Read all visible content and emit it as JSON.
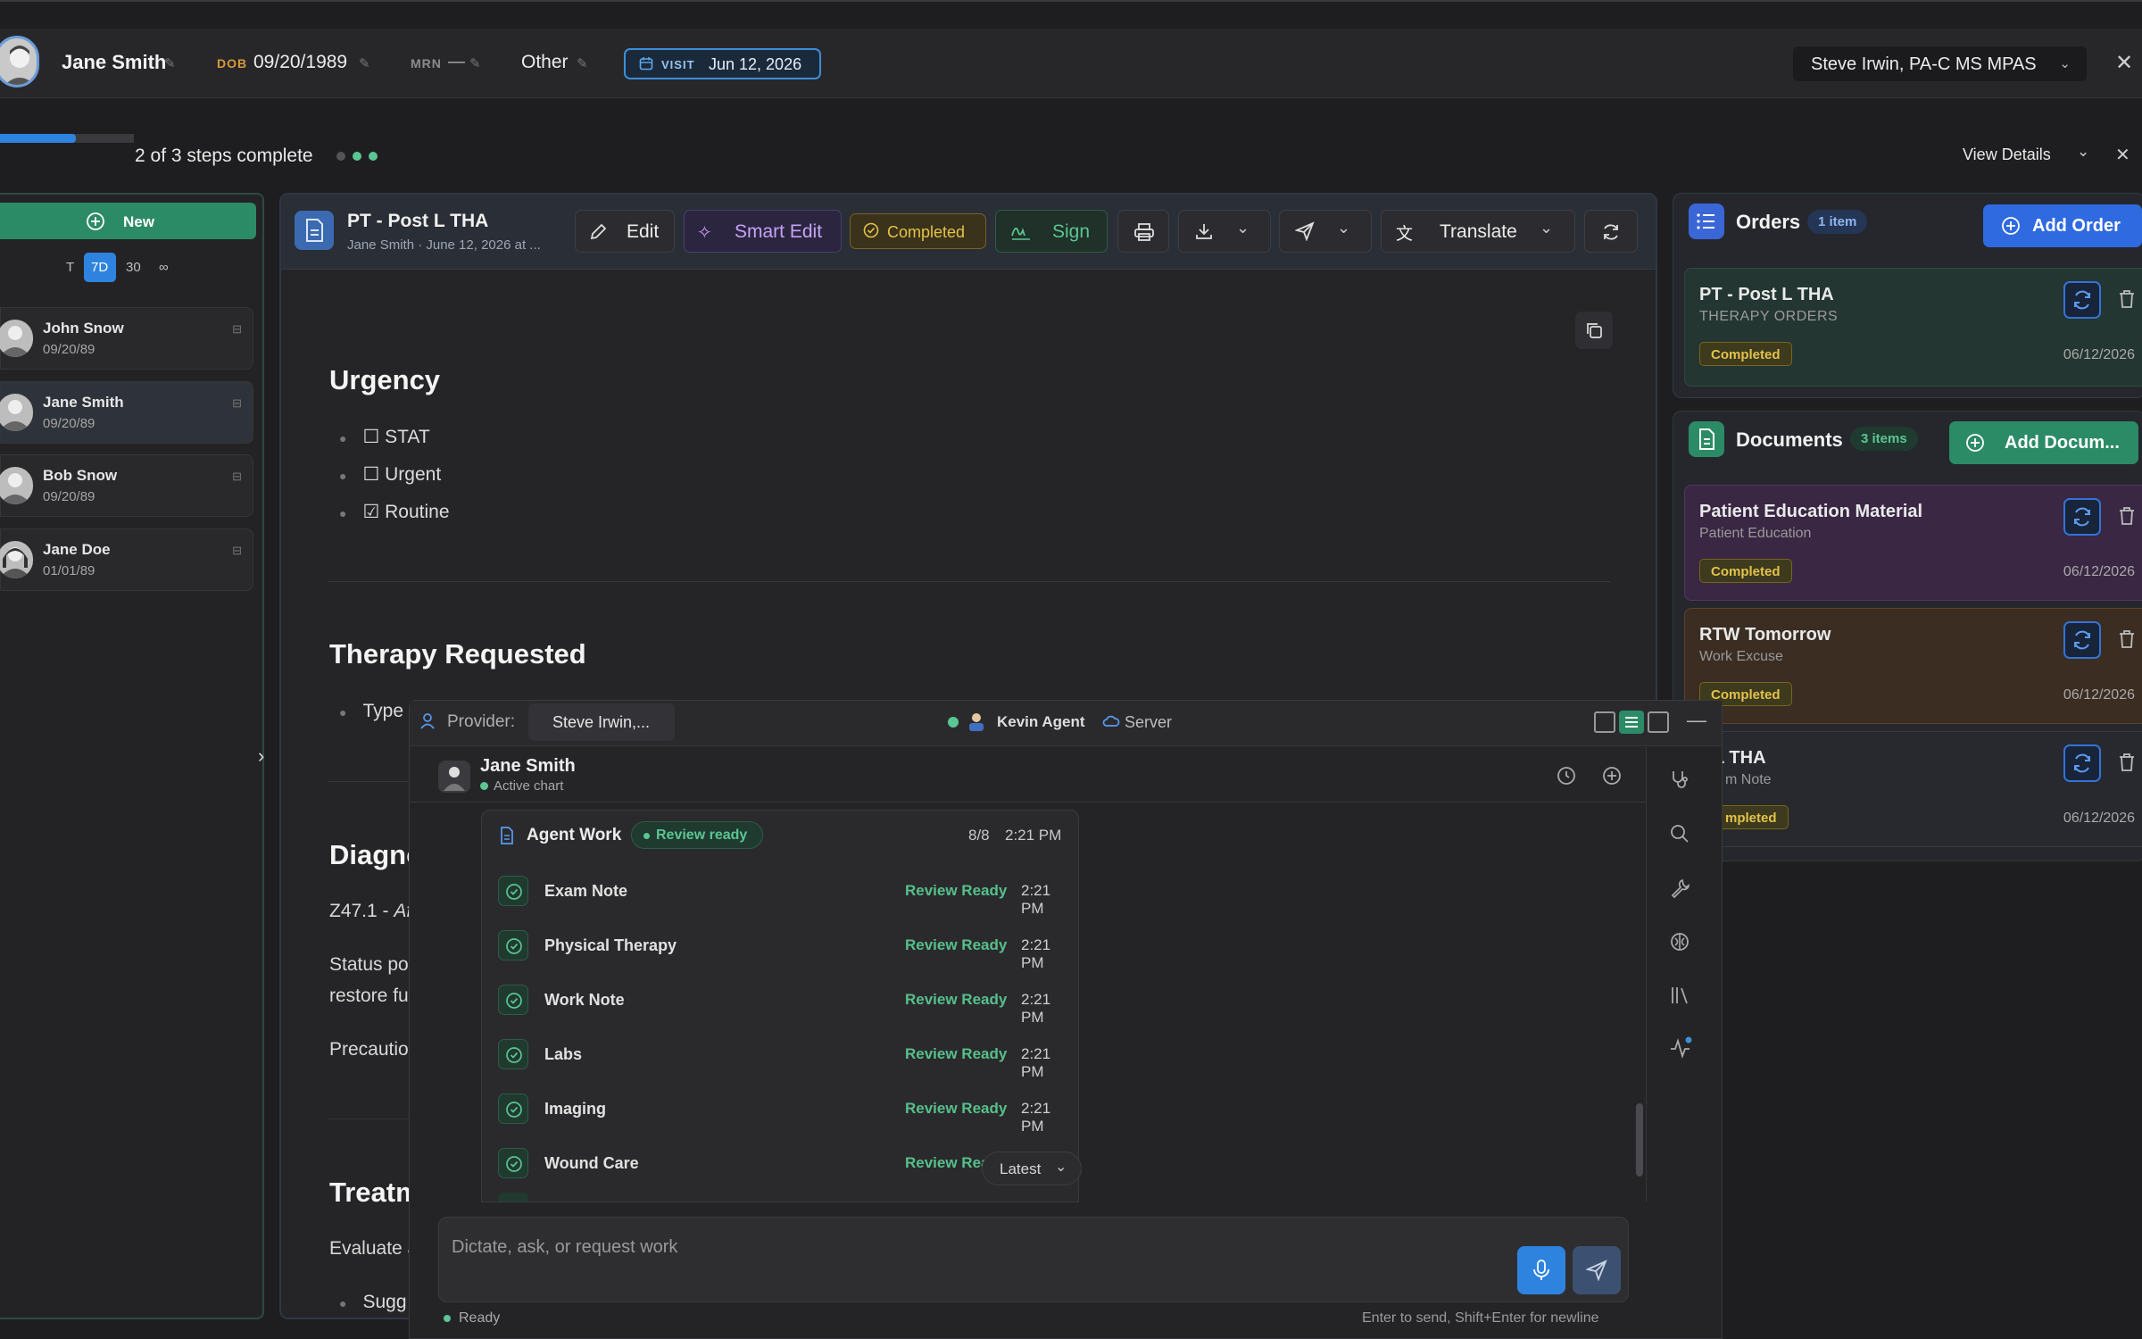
{
  "topbar": {
    "patient_name": "Jane Smith",
    "dob_label": "DOB",
    "dob": "09/20/1989",
    "mrn_label": "MRN",
    "mrn": "—",
    "gender": "Other",
    "visit_label": "VISIT",
    "visit_date": "Jun 12, 2026",
    "provider": "Steve Irwin, PA-C MS MPAS"
  },
  "progress": {
    "text": "2 of 3 steps complete",
    "fraction": 0.57,
    "view_details": "View Details"
  },
  "sidebar": {
    "new_label": "New",
    "ranges": [
      "T",
      "7D",
      "30",
      "∞"
    ],
    "active_range": "7D",
    "patients": [
      {
        "name": "John Snow",
        "dob": "09/20/89"
      },
      {
        "name": "Jane Smith",
        "dob": "09/20/89"
      },
      {
        "name": "Bob Snow",
        "dob": "09/20/89"
      },
      {
        "name": "Jane Doe",
        "dob": "01/01/89"
      }
    ]
  },
  "document": {
    "title": "PT - Post L THA",
    "subtitle": "Jane Smith · June 12, 2026 at ...",
    "toolbar": {
      "edit": "Edit",
      "smart_edit": "Smart Edit",
      "completed": "Completed",
      "sign": "Sign",
      "translate": "Translate"
    },
    "urgency_heading": "Urgency",
    "urgency_items": [
      "☐ STAT",
      "☐ Urgent",
      "☑ Routine"
    ],
    "therapy_heading": "Therapy Requested",
    "therapy_item": "Type",
    "diagnosis_heading": "Diagno",
    "diagnosis_code": "Z47.1 - ",
    "diagnosis_code_italic": "Af",
    "status_line1": "Status po",
    "status_line2": "restore fu",
    "precautions": "Precautio",
    "treatment_heading": "Treatm",
    "evaluate": "Evaluate a",
    "suggest": "Sugg"
  },
  "orders": {
    "title": "Orders",
    "count": "1 item",
    "add_label": "Add Order",
    "items": [
      {
        "title": "PT - Post L THA",
        "subtitle": "THERAPY ORDERS",
        "status": "Completed",
        "date": "06/12/2026"
      }
    ]
  },
  "documents": {
    "title": "Documents",
    "count": "3 items",
    "add_label": "Add Docum...",
    "items": [
      {
        "title": "Patient Education Material",
        "subtitle": "Patient Education",
        "status": "Completed",
        "date": "06/12/2026"
      },
      {
        "title": "RTW Tomorrow",
        "subtitle": "Work Excuse",
        "status": "Completed",
        "date": "06/12/2026"
      },
      {
        "title": "L THA",
        "subtitle": "m Note",
        "status": "mpleted",
        "date": "06/12/2026"
      }
    ]
  },
  "chat": {
    "provider_label": "Provider:",
    "provider_value": "Steve Irwin,...",
    "agent_name": "Kevin Agent",
    "server_label": "Server",
    "patient_name": "Jane Smith",
    "chart_status": "Active chart",
    "agent_work_title": "Agent Work",
    "review_badge": "Review ready",
    "agent_count": "8/8",
    "agent_time": "2:21 PM",
    "tasks": [
      {
        "name": "Exam Note",
        "status": "Review Ready",
        "time": "2:21 PM"
      },
      {
        "name": "Physical Therapy",
        "status": "Review Ready",
        "time": "2:21 PM"
      },
      {
        "name": "Work Note",
        "status": "Review Ready",
        "time": "2:21 PM"
      },
      {
        "name": "Labs",
        "status": "Review Ready",
        "time": "2:21 PM"
      },
      {
        "name": "Imaging",
        "status": "Review Ready",
        "time": "2:21 PM"
      },
      {
        "name": "Wound Care",
        "status": "Review Ready",
        "time": ""
      }
    ],
    "latest_label": "Latest",
    "input_placeholder": "Dictate, ask, or request work",
    "status": "Ready",
    "hint": "Enter to send, Shift+Enter for newline"
  },
  "colors": {
    "accent_blue": "#2e83df",
    "success_green": "#2c8b67",
    "review_green": "#56c08a",
    "completed_yellow": "#e3c24c",
    "smart_edit_purple": "#b78cf0"
  }
}
